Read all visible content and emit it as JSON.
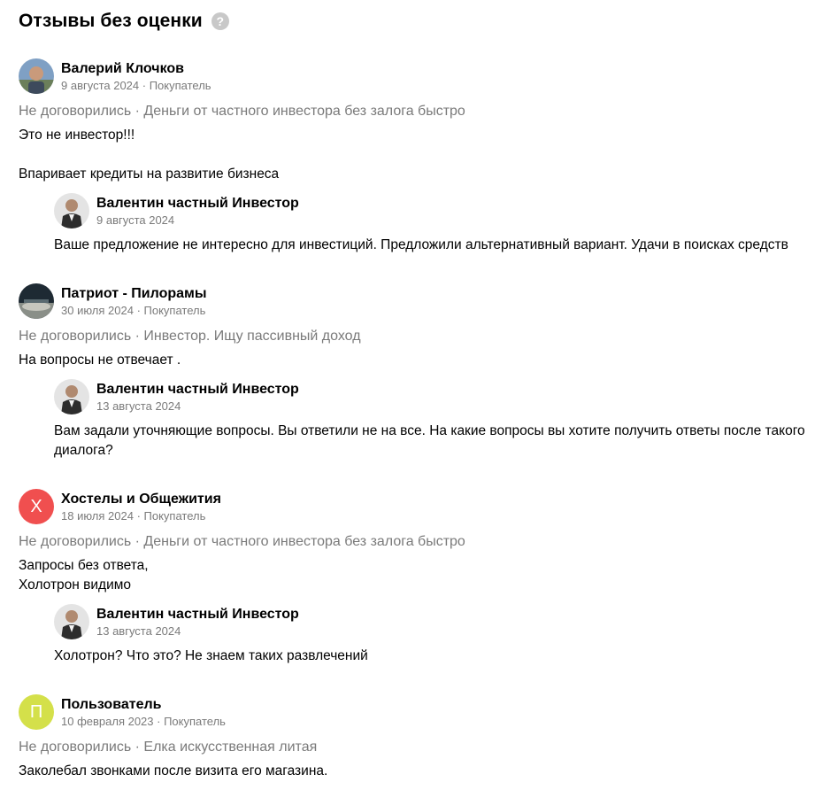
{
  "header": {
    "title": "Отзывы без оценки",
    "help_icon": "?"
  },
  "reviews": [
    {
      "author": "Валерий Клочков",
      "meta": "9 августа 2024 · Покупатель",
      "deal": "Не договорились · Деньги от частного инвестора без залога быстро",
      "text": "Это не инвестор!!!\n\nВпаривает кредиты на развитие бизнеса",
      "reply": {
        "author": "Валентин частный Инвестор",
        "date": "9 августа 2024",
        "text": "Ваше предложение не интересно для инвестиций. Предложили альтернативный вариант. Удачи в поисках средств"
      }
    },
    {
      "author": "Патриот - Пилорамы",
      "meta": "30 июля 2024 · Покупатель",
      "deal": "Не договорились · Инвестор. Ищу пассивный доход",
      "text": "На вопросы не отвечает .",
      "reply": {
        "author": "Валентин частный Инвестор",
        "date": "13 августа 2024",
        "text": "Вам задали уточняющие вопросы. Вы ответили не на все. На какие вопросы вы хотите получить ответы после такого диалога?"
      }
    },
    {
      "author": "Хостелы и Общежития",
      "avatar_letter": "Х",
      "avatar_color": "#f04f4f",
      "meta": "18 июля 2024 · Покупатель",
      "deal": "Не договорились · Деньги от частного инвестора без залога быстро",
      "text": "Запросы без ответа,\nХолотрон видимо",
      "reply": {
        "author": "Валентин частный Инвестор",
        "date": "13 августа 2024",
        "text": "Холотрон? Что это? Не знаем таких развлечений"
      }
    },
    {
      "author": "Пользователь",
      "avatar_letter": "П",
      "avatar_color": "#d4e04a",
      "meta": "10 февраля 2023 · Покупатель",
      "deal": "Не договорились · Елка искусственная литая",
      "text": "Заколебал звонками после визита его магазина."
    }
  ]
}
